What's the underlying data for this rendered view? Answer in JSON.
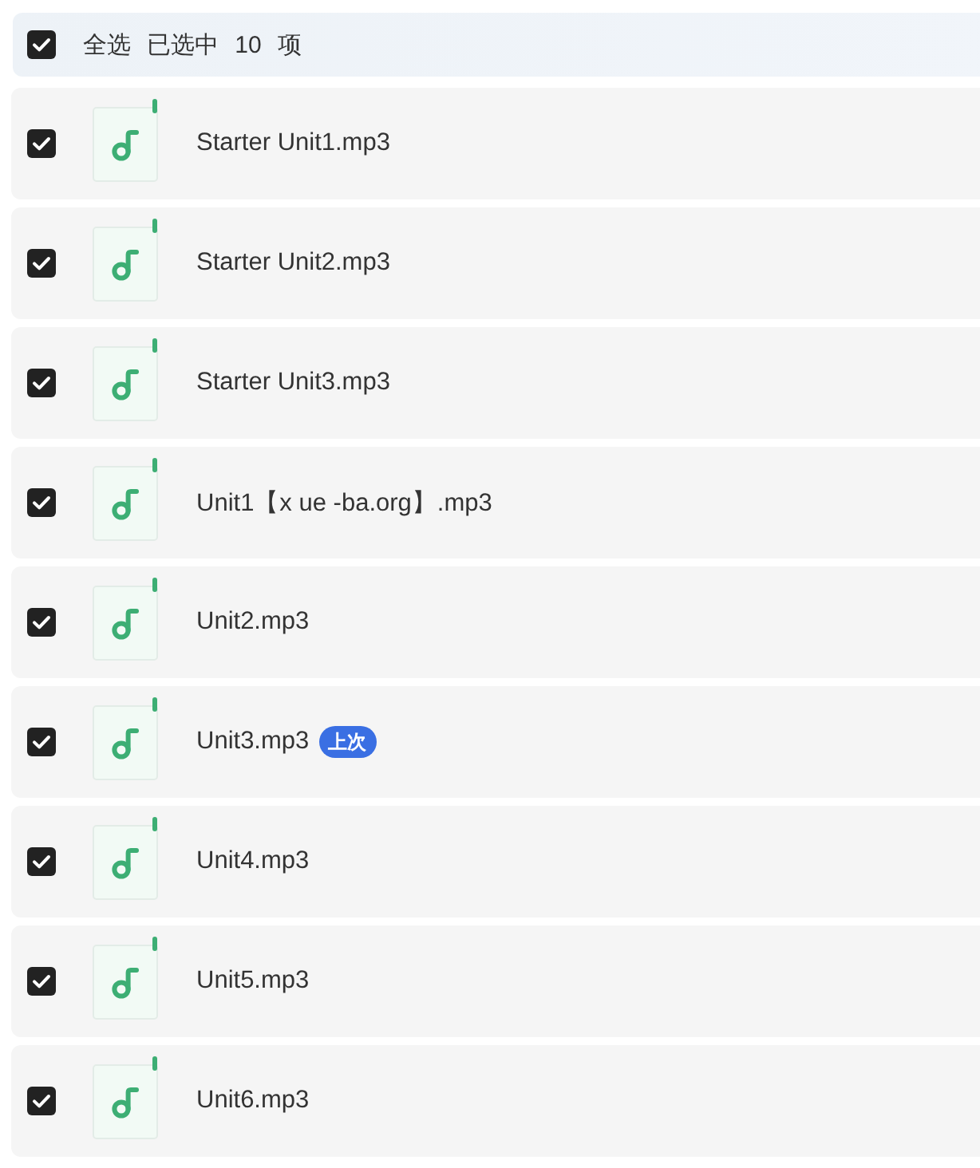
{
  "select_all": {
    "checked": true,
    "label": "全选",
    "selection_count": "已选中 10 项"
  },
  "files": [
    {
      "name": "Starter Unit1.mp3",
      "checked": true
    },
    {
      "name": "Starter Unit2.mp3",
      "checked": true
    },
    {
      "name": "Starter Unit3.mp3",
      "checked": true
    },
    {
      "name": "Unit1【x ue -ba.org】.mp3",
      "checked": true
    },
    {
      "name": "Unit2.mp3",
      "checked": true
    },
    {
      "name": "Unit3.mp3",
      "checked": true,
      "badge": "上次"
    },
    {
      "name": "Unit4.mp3",
      "checked": true
    },
    {
      "name": "Unit5.mp3",
      "checked": true
    },
    {
      "name": "Unit6.mp3",
      "checked": true
    }
  ]
}
